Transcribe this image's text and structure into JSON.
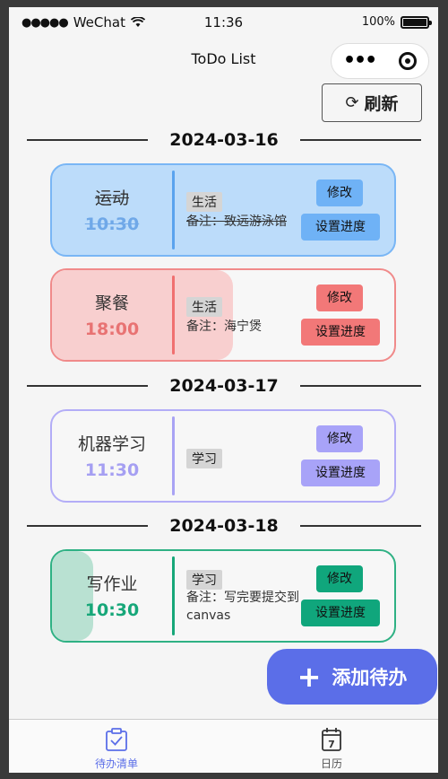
{
  "status_bar": {
    "signal": "●●●●●",
    "carrier": "WeChat",
    "time": "11:36",
    "battery": "100%"
  },
  "nav": {
    "title": "ToDo List"
  },
  "refresh_label": "刷新",
  "groups": [
    {
      "date": "2024-03-16",
      "items": [
        {
          "name": "运动",
          "time": "10:30",
          "tag": "生活",
          "note": "备注：致远游泳馆",
          "edit": "修改",
          "progress_label": "设置进度",
          "progress": 1.0,
          "completed": true
        },
        {
          "name": "聚餐",
          "time": "18:00",
          "tag": "生活",
          "note": "备注：海宁煲",
          "edit": "修改",
          "progress_label": "设置进度",
          "progress": 0.53,
          "completed": false
        }
      ]
    },
    {
      "date": "2024-03-17",
      "items": [
        {
          "name": "机器学习",
          "time": "11:30",
          "tag": "学习",
          "note": "",
          "edit": "修改",
          "progress_label": "设置进度",
          "progress": 0.0,
          "completed": false
        }
      ]
    },
    {
      "date": "2024-03-18",
      "items": [
        {
          "name": "写作业",
          "time": "10:30",
          "tag": "学习",
          "note": "备注：写完要提交到canvas",
          "edit": "修改",
          "progress_label": "设置进度",
          "progress": 0.12,
          "completed": false
        }
      ]
    }
  ],
  "add_button": "添加待办",
  "tabs": [
    {
      "label": "待办清单",
      "active": true
    },
    {
      "label": "日历",
      "active": false
    }
  ],
  "calendar_icon_day": "7",
  "colors": {
    "blue": "#79b6f5",
    "blue_fill": "#bcdcfa",
    "blue_btn": "#6fb2f6",
    "red": "#f08a8a",
    "red_fill": "#f8cfcf",
    "red_btn": "#f27878",
    "red_text": "#e87373",
    "purple": "#b3adf7",
    "purple_btn": "#a8a3f8",
    "purple_text": "#a59ff2",
    "green": "#2fb184",
    "green_fill": "#b9e1d2",
    "green_btn": "#10a67c",
    "green_text": "#17a779",
    "accent": "#5b6ee8",
    "tab_active": "#5b6ee8"
  }
}
